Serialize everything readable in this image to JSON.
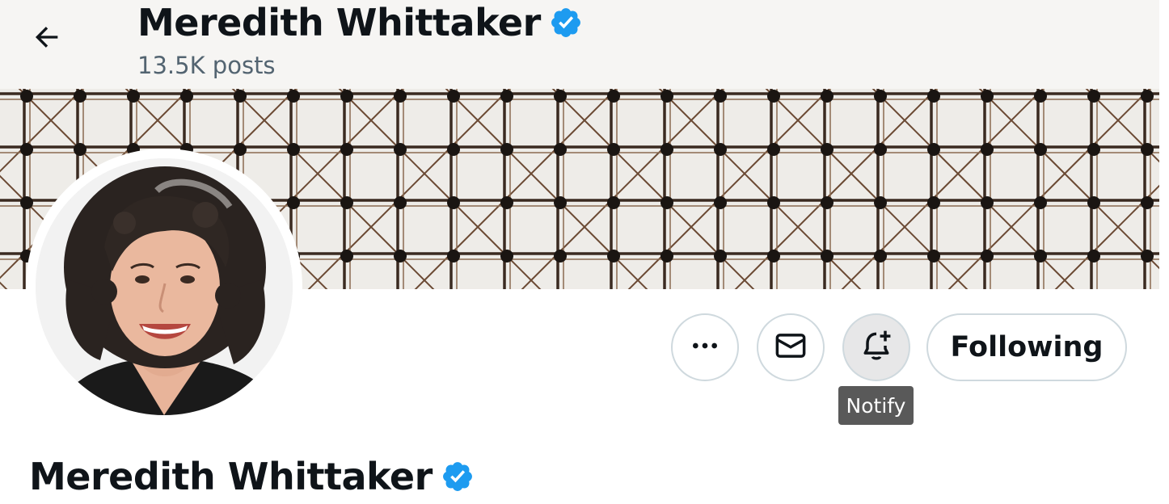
{
  "header": {
    "name": "Meredith Whittaker",
    "posts_count": "13.5K posts",
    "back_icon": "arrow-left-icon",
    "verified_icon": "verified-badge-icon"
  },
  "profile": {
    "name": "Meredith Whittaker",
    "verified": true
  },
  "actions": {
    "more_icon": "more-horizontal-icon",
    "message_icon": "envelope-icon",
    "notify_icon": "bell-plus-icon",
    "following_label": "Following",
    "notify_tooltip": "Notify"
  },
  "colors": {
    "verified_blue": "#1d9bf0",
    "text_primary": "#0f1419",
    "text_secondary": "#536471",
    "border": "#cfd9de",
    "tooltip_bg": "#595959"
  }
}
